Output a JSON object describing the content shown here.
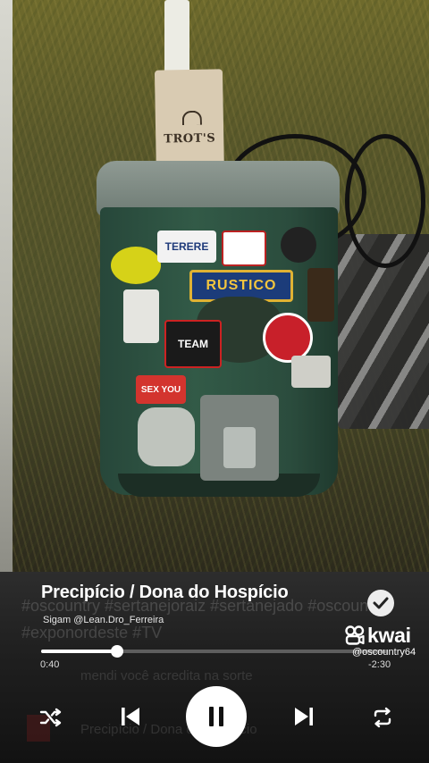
{
  "photo": {
    "tag_text": "TROT'S",
    "stickers": {
      "rustico": "RUSTICO",
      "terere": "TERERE",
      "team": "TEAM",
      "sexy": "SEX YOU"
    }
  },
  "player": {
    "title": "Precipício / Dona do Hospício",
    "artist": "Sigam @Lean.Dro_Ferreira",
    "time_current": "0:40",
    "time_remaining": "-2:30",
    "progress_fraction": 0.22
  },
  "watermark": {
    "brand": "kwai",
    "username": "@oscountry64"
  },
  "background_overlay": {
    "line1": "#oscountry #sertanejoraiz #sertanejado #oscountry",
    "line2": "#exponordeste #TV",
    "line3": "mendi você acredita na sorte",
    "line4": "Precipício / Dona do Hospício"
  },
  "icons": {
    "shuffle": "shuffle-icon",
    "previous": "previous-icon",
    "pause": "pause-icon",
    "next": "next-icon",
    "repeat": "repeat-icon",
    "check": "check-icon"
  },
  "colors": {
    "accent": "#ffffff",
    "overlay_bg": "#1e1e1e"
  }
}
